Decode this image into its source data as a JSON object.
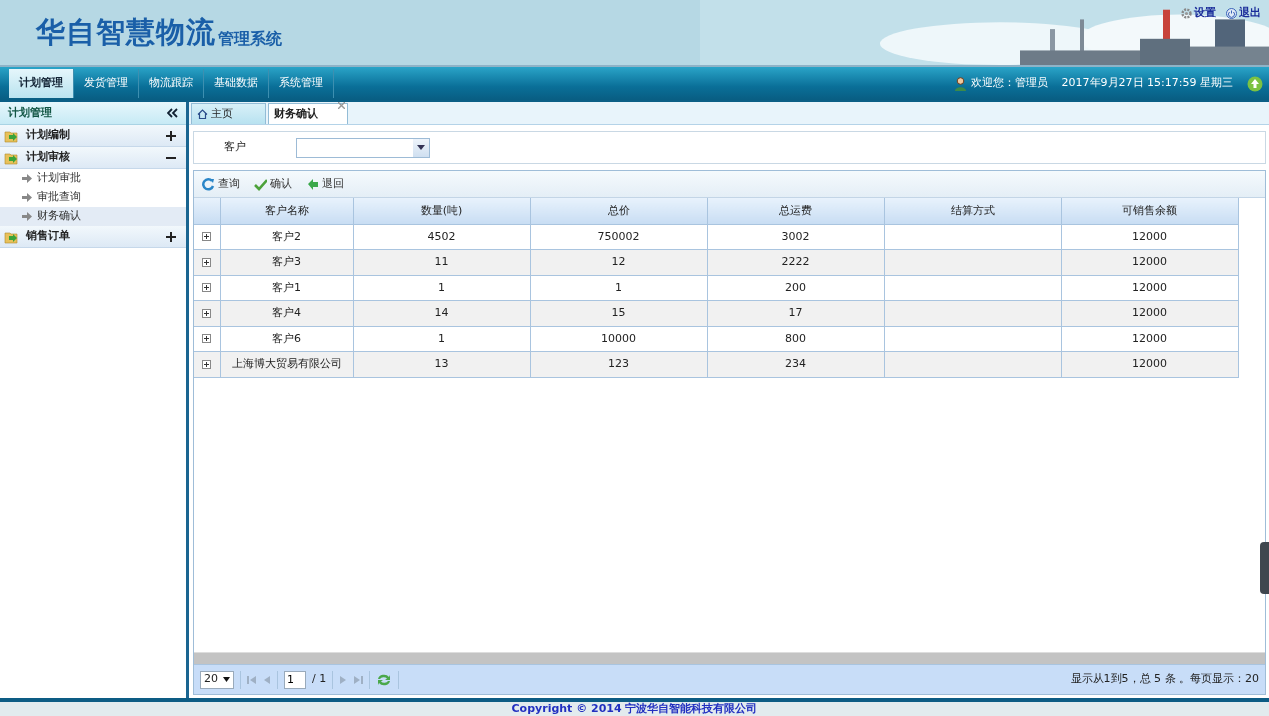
{
  "header": {
    "logo_main": "华自智慧物流",
    "logo_sub": "管理系统",
    "links": [
      {
        "kind": "settings",
        "label": "设置"
      },
      {
        "kind": "logout",
        "label": "退出"
      }
    ]
  },
  "nav": {
    "items": [
      {
        "label": "计划管理",
        "selected": true
      },
      {
        "label": "发货管理",
        "selected": false
      },
      {
        "label": "物流跟踪",
        "selected": false
      },
      {
        "label": "基础数据",
        "selected": false
      },
      {
        "label": "系统管理",
        "selected": false
      }
    ],
    "welcome": "欢迎您：管理员",
    "datetime": "2017年9月27日 15:17:59  星期三"
  },
  "sidebar": {
    "title": "计划管理",
    "groups": [
      {
        "label": "计划编制",
        "expanded": false
      },
      {
        "label": "计划审核",
        "expanded": true,
        "children": [
          {
            "label": "计划审批",
            "selected": false
          },
          {
            "label": "审批查询",
            "selected": false
          },
          {
            "label": "财务确认",
            "selected": true
          }
        ]
      },
      {
        "label": "销售订单",
        "expanded": false
      }
    ]
  },
  "tabs": [
    {
      "label": "主页",
      "kind": "home",
      "selected": false
    },
    {
      "label": "财务确认",
      "kind": "page",
      "selected": true
    }
  ],
  "filter": {
    "label": "客户"
  },
  "toolbar": [
    {
      "kind": "query",
      "label": "查询"
    },
    {
      "kind": "confirm",
      "label": "确认"
    },
    {
      "kind": "back",
      "label": "退回"
    }
  ],
  "table": {
    "columns": [
      "客户名称",
      "数量(吨)",
      "总价",
      "总运费",
      "结算方式",
      "可销售余额"
    ],
    "rows": [
      [
        "客户2",
        "4502",
        "750002",
        "3002",
        "",
        "12000"
      ],
      [
        "客户3",
        "11",
        "12",
        "2222",
        "",
        "12000"
      ],
      [
        "客户1",
        "1",
        "1",
        "200",
        "",
        "12000"
      ],
      [
        "客户4",
        "14",
        "15",
        "17",
        "",
        "12000"
      ],
      [
        "客户6",
        "1",
        "10000",
        "800",
        "",
        "12000"
      ],
      [
        "上海博大贸易有限公司",
        "13",
        "123",
        "234",
        "",
        "12000"
      ]
    ]
  },
  "pager": {
    "page_size": "20",
    "page": "1",
    "total_pages": "/ 1",
    "summary": "显示从1到5，总 5 条 。每页显示：20"
  },
  "footer": "Copyright © 2014 宁波华自智能科技有限公司"
}
